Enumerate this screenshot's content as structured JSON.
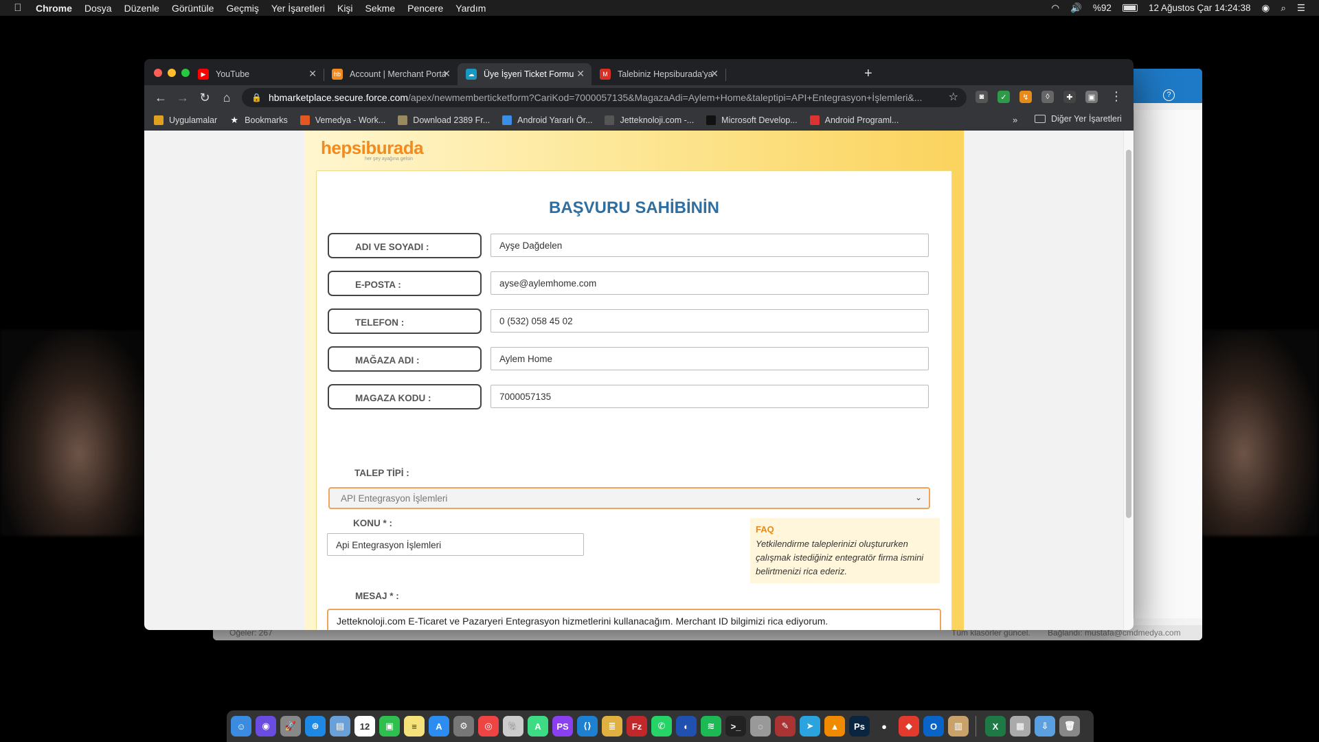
{
  "menubar": {
    "apple_icon": "apple-icon",
    "items": [
      "Chrome",
      "Dosya",
      "Düzenle",
      "Görüntüle",
      "Geçmiş",
      "Yer İşaretleri",
      "Kişi",
      "Sekme",
      "Pencere",
      "Yardım"
    ],
    "battery": "%92",
    "datetime": "12 Ağustos Çar  14:24:38"
  },
  "background_window": {
    "status_items": "Öğeler: 267",
    "status_folders": "Tüm klasörler güncel.",
    "status_connected": "Bağlandı: mustafa@cmdmedya.com",
    "help_icon": "?"
  },
  "tabs": [
    {
      "title": "YouTube",
      "favicon": "youtube-icon",
      "color": "#ff0000",
      "glyph": "▶",
      "active": false
    },
    {
      "title": "Account | Merchant Portal",
      "favicon": "hb-icon",
      "color": "#f28b1e",
      "glyph": "hb",
      "active": false
    },
    {
      "title": "Üye İşyeri Ticket Formu",
      "favicon": "salesforce-icon",
      "color": "#1798c1",
      "glyph": "☁",
      "active": true
    },
    {
      "title": "Talebiniz Hepsiburada'ya Ulaştı",
      "favicon": "gmail-icon",
      "color": "#d93025",
      "glyph": "M",
      "active": false
    }
  ],
  "toolbar": {
    "url_host": "hbmarketplace.secure.force.com",
    "url_path": "/apex/newmemberticketform?CariKod=7000057135&MagazaAdi=Aylem+Home&taleptipi=API+Entegrasyon+İşlemleri&..."
  },
  "bookmarks": [
    {
      "label": "Uygulamalar",
      "icon": "apps-grid-icon",
      "color": "#e0a020"
    },
    {
      "label": "Bookmarks",
      "icon": "star-icon",
      "color": "#35363a"
    },
    {
      "label": "Vemedya - Work...",
      "icon": "vemedya-icon",
      "color": "#e25822"
    },
    {
      "label": "Download 2389 Fr...",
      "icon": "download-icon",
      "color": "#9a8a60"
    },
    {
      "label": "Android Yararlı Ör...",
      "icon": "android-icon",
      "color": "#3a8ee6"
    },
    {
      "label": "Jetteknoloji.com -...",
      "icon": "jet-icon",
      "color": "#555"
    },
    {
      "label": "Microsoft Develop...",
      "icon": "medium-icon",
      "color": "#111"
    },
    {
      "label": "Android Programl...",
      "icon": "android-prog-icon",
      "color": "#d33"
    }
  ],
  "bookmarks_other": "Diğer Yer İşaretleri",
  "page": {
    "logo": "hepsiburada",
    "logo_tagline": "her şey ayağına gelsin",
    "heading": "BAŞVURU SAHİBİNİN",
    "fields": [
      {
        "label": "ADI VE SOYADI :",
        "value": "Ayşe Dağdelen"
      },
      {
        "label": "E-POSTA :",
        "value": "ayse@aylemhome.com"
      },
      {
        "label": "TELEFON :",
        "value": "0 (532) 058 45 02"
      },
      {
        "label": "MAĞAZA ADI :",
        "value": "Aylem Home"
      },
      {
        "label": "MAGAZA KODU :",
        "value": "7000057135"
      }
    ],
    "talep_label": "TALEP TİPİ :",
    "talep_value": "API Entegrasyon İşlemleri",
    "konu_label": "KONU * :",
    "konu_value": "Api Entegrasyon İşlemleri",
    "faq_title": "FAQ",
    "faq_body": "Yetkilendirme taleplerinizi oluştururken çalışmak istediğiniz entegratör firma ismini belirtmenizi rica ederiz.",
    "mesaj_label": "MESAJ * :",
    "mesaj_value": "Jetteknoloji.com E-Ticaret ve Pazaryeri Entegrasyon hizmetlerini kullanacağım. Merchant ID bilgimizi rica ediyorum."
  },
  "dock": [
    {
      "name": "finder-icon",
      "color": "#3b8be0",
      "glyph": "☺"
    },
    {
      "name": "siri-icon",
      "color": "#6a4ce0",
      "glyph": "◉"
    },
    {
      "name": "launchpad-icon",
      "color": "#888",
      "glyph": "🚀"
    },
    {
      "name": "safari-icon",
      "color": "#1e88e5",
      "glyph": "⊕"
    },
    {
      "name": "preview-icon",
      "color": "#6aa0d8",
      "glyph": "▤"
    },
    {
      "name": "calendar-icon",
      "color": "#fff",
      "glyph": "12"
    },
    {
      "name": "facetime-icon",
      "color": "#2fbf4e",
      "glyph": "▣"
    },
    {
      "name": "notes-icon",
      "color": "#f5e27a",
      "glyph": "≡"
    },
    {
      "name": "appstore-icon",
      "color": "#2d8cf0",
      "glyph": "A"
    },
    {
      "name": "system-prefs-icon",
      "color": "#777",
      "glyph": "⚙"
    },
    {
      "name": "chrome-icon",
      "color": "#e44",
      "glyph": "◎"
    },
    {
      "name": "sequel-icon",
      "color": "#ccc",
      "glyph": "🐘"
    },
    {
      "name": "android-studio-icon",
      "color": "#3ddc84",
      "glyph": "A"
    },
    {
      "name": "phpstorm-icon",
      "color": "#8a3ff0",
      "glyph": "PS"
    },
    {
      "name": "vscode-icon",
      "color": "#1e80d0",
      "glyph": "⟨⟩"
    },
    {
      "name": "db-icon",
      "color": "#e0b040",
      "glyph": "≣"
    },
    {
      "name": "filezilla-icon",
      "color": "#c0282a",
      "glyph": "Fz"
    },
    {
      "name": "whatsapp-icon",
      "color": "#25d366",
      "glyph": "✆"
    },
    {
      "name": "firefox-icon",
      "color": "#2050b0",
      "glyph": "◐"
    },
    {
      "name": "spotify-icon",
      "color": "#1db954",
      "glyph": "≋"
    },
    {
      "name": "terminal-icon",
      "color": "#222",
      "glyph": ">_"
    },
    {
      "name": "utility-icon",
      "color": "#999",
      "glyph": "◌"
    },
    {
      "name": "brush-icon",
      "color": "#a33",
      "glyph": "✎"
    },
    {
      "name": "telegram-icon",
      "color": "#2aa3df",
      "glyph": "➤"
    },
    {
      "name": "vlc-icon",
      "color": "#f08a00",
      "glyph": "▲"
    },
    {
      "name": "photoshop-icon",
      "color": "#0a2540",
      "glyph": "Ps"
    },
    {
      "name": "obs-icon",
      "color": "#333",
      "glyph": "●"
    },
    {
      "name": "anydesk-icon",
      "color": "#e23b2e",
      "glyph": "◆"
    },
    {
      "name": "outlook-icon",
      "color": "#0a64c8",
      "glyph": "O"
    },
    {
      "name": "docs-icon",
      "color": "#c8a26a",
      "glyph": "▥"
    },
    {
      "name": "excel-icon",
      "color": "#1e7a45",
      "glyph": "X"
    },
    {
      "name": "file-icon",
      "color": "#aaa",
      "glyph": "▦"
    },
    {
      "name": "downloads-icon",
      "color": "#5aa0e0",
      "glyph": "⇩"
    },
    {
      "name": "trash-icon",
      "color": "#888",
      "glyph": "🗑"
    }
  ]
}
